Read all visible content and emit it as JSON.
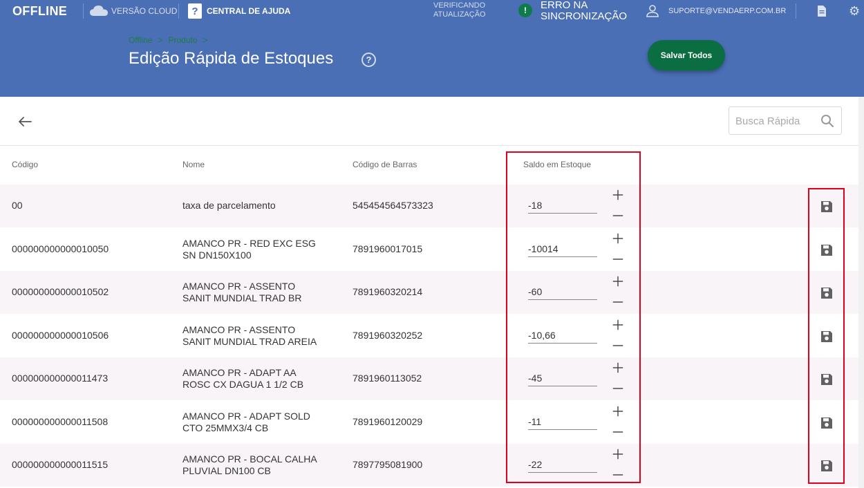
{
  "topbar": {
    "brand": "OFFLINE",
    "cloud_label": "VERSÃO CLOUD",
    "help_label": "CENTRAL DE AJUDA",
    "help_box_glyph": "?",
    "update_line1": "VERIFICANDO",
    "update_line2": "ATUALIZAÇÃO",
    "error_glyph": "!",
    "error_line1": "ERRO NA",
    "error_line2": "SINCRONIZAÇÃO",
    "user_email": "SUPORTE@VENDAERP.COM.BR",
    "icons": [
      "cloud-icon",
      "help-icon",
      "alert-icon",
      "user-icon",
      "document-icon",
      "gear-icon"
    ]
  },
  "header": {
    "breadcrumb": [
      "Offline",
      "Produto"
    ],
    "breadcrumb_separator": ">",
    "title": "Edição Rápida de Estoques",
    "title_help_glyph": "?",
    "save_all_label": "Salvar Todos"
  },
  "toolbar": {
    "search_placeholder": "Busca Rápida"
  },
  "table": {
    "headers": {
      "code": "Código",
      "name": "Nome",
      "barcode": "Código de Barras",
      "stock": "Saldo em Estoque"
    },
    "rows": [
      {
        "code": "00",
        "name_line1": "taxa de parcelamento",
        "name_line2": "",
        "barcode": "545454564573323",
        "stock": "-18"
      },
      {
        "code": "000000000000010050",
        "name_line1": "AMANCO PR - RED EXC ESG",
        "name_line2": "SN DN150X100",
        "barcode": "7891960017015",
        "stock": "-10014"
      },
      {
        "code": "000000000000010502",
        "name_line1": "AMANCO PR - ASSENTO",
        "name_line2": "SANIT MUNDIAL TRAD BR",
        "barcode": "7891960320214",
        "stock": "-60"
      },
      {
        "code": "000000000000010506",
        "name_line1": "AMANCO PR - ASSENTO",
        "name_line2": "SANIT MUNDIAL TRAD AREIA",
        "barcode": "7891960320252",
        "stock": "-10,66"
      },
      {
        "code": "000000000000011473",
        "name_line1": "AMANCO PR - ADAPT AA",
        "name_line2": "ROSC CX DAGUA 1 1/2 CB",
        "barcode": "7891960113052",
        "stock": "-45"
      },
      {
        "code": "000000000000011508",
        "name_line1": "AMANCO PR - ADAPT SOLD",
        "name_line2": "CTO 25MMX3/4 CB",
        "barcode": "7891960120029",
        "stock": "-11"
      },
      {
        "code": "000000000000011515",
        "name_line1": "AMANCO PR - BOCAL CALHA",
        "name_line2": "PLUVIAL DN100 CB",
        "barcode": "7897795081900",
        "stock": "-22"
      }
    ]
  },
  "colors": {
    "header_blue": "#4a6fb5",
    "save_green": "#0b6e42",
    "breadcrumb_green": "#1f7a48",
    "highlight_red": "#e0001b",
    "row_alt": "#f8f4f8"
  }
}
